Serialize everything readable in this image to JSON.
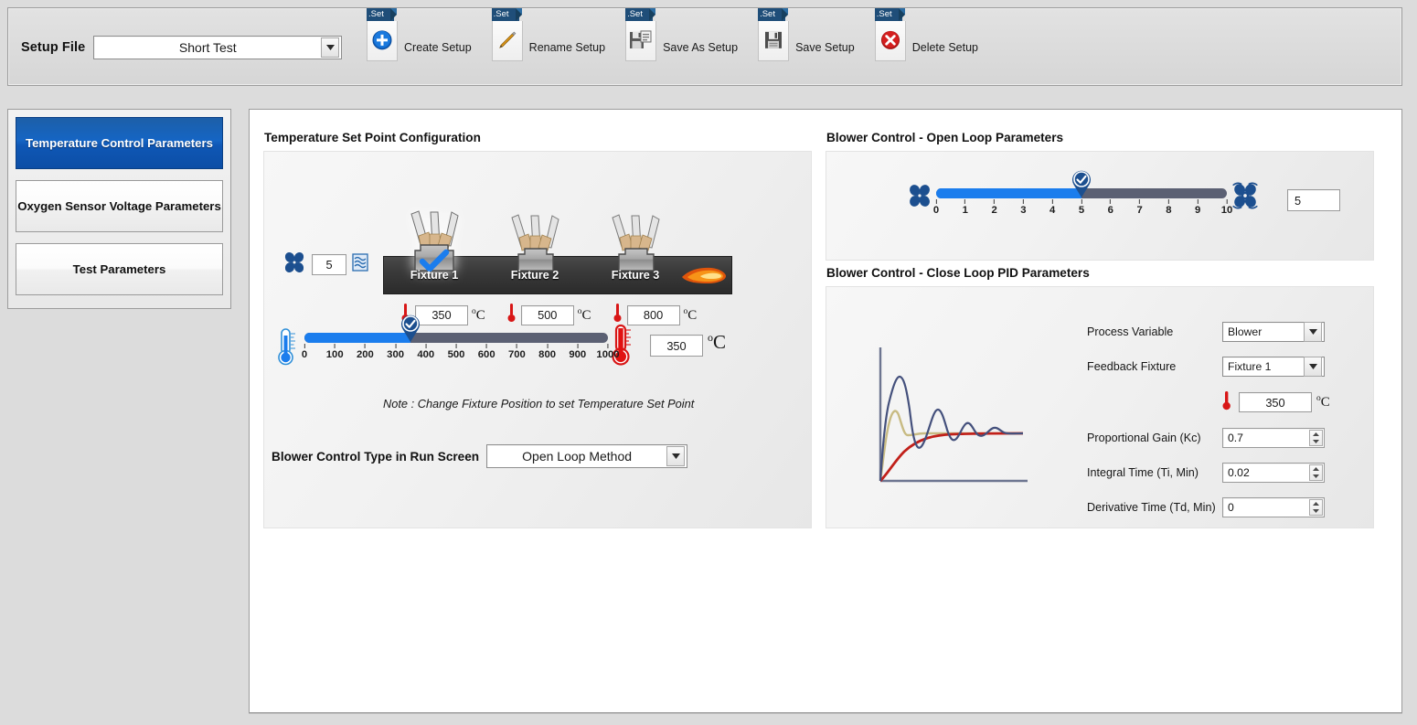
{
  "toolbar": {
    "setup_file_label": "Setup File",
    "setup_file_value": "Short Test",
    "buttons": [
      {
        "label": "Create Setup",
        "badge": ".Set",
        "icon": "plus-circle-icon"
      },
      {
        "label": "Rename Setup",
        "badge": ".Set",
        "icon": "pencil-icon"
      },
      {
        "label": "Save As Setup",
        "badge": ".Set",
        "icon": "save-as-floppy-icon"
      },
      {
        "label": "Save Setup",
        "badge": ".Set",
        "icon": "save-floppy-icon"
      },
      {
        "label": "Delete Setup",
        "badge": ".Set",
        "icon": "delete-circle-icon"
      }
    ]
  },
  "sidebar": {
    "items": [
      {
        "label": "Temperature Control Parameters",
        "active": true
      },
      {
        "label": "Oxygen Sensor Voltage Parameters",
        "active": false
      },
      {
        "label": "Test Parameters",
        "active": false
      }
    ]
  },
  "temperature_setpoint": {
    "title": "Temperature Set Point Configuration",
    "fan_count": "5",
    "fixtures": [
      {
        "name": "Fixture 1",
        "selected": true,
        "temperature": "350",
        "unit": "C"
      },
      {
        "name": "Fixture 2",
        "selected": false,
        "temperature": "500",
        "unit": "C"
      },
      {
        "name": "Fixture 3",
        "selected": false,
        "temperature": "800",
        "unit": "C"
      }
    ],
    "slider": {
      "min": 0,
      "max": 1000,
      "value": 350,
      "ticks": [
        "0",
        "100",
        "200",
        "300",
        "400",
        "500",
        "600",
        "700",
        "800",
        "900",
        "1000"
      ]
    },
    "value_box": "350",
    "value_unit": "C",
    "note": "Note : Change Fixture Position to set Temperature Set Point",
    "blower_control_type_label": "Blower Control Type in Run Screen",
    "blower_control_type_value": "Open Loop Method"
  },
  "open_loop": {
    "title": "Blower Control - Open Loop Parameters",
    "slider": {
      "min": 0,
      "max": 10,
      "value": 5,
      "ticks": [
        "0",
        "1",
        "2",
        "3",
        "4",
        "5",
        "6",
        "7",
        "8",
        "9",
        "10"
      ]
    },
    "value_box": "5"
  },
  "pid": {
    "title": "Blower Control - Close Loop PID Parameters",
    "process_variable_label": "Process Variable",
    "process_variable_value": "Blower",
    "feedback_fixture_label": "Feedback Fixture",
    "feedback_fixture_value": "Fixture 1",
    "feedback_temperature": "350",
    "feedback_temperature_unit": "C",
    "proportional_label": "Proportional Gain (Kc)",
    "proportional_value": "0.7",
    "integral_label": "Integral Time (Ti, Min)",
    "integral_value": "0.02",
    "derivative_label": "Derivative Time (Td, Min)",
    "derivative_value": "0"
  },
  "colors": {
    "accent_blue": "#1b7ded",
    "sidebar_active": "#0f57b5",
    "track_gray": "#5b6073",
    "badge_navy": "#1f4e79",
    "flame_orange": "#f07818",
    "thermo_red": "#d81616",
    "chart_navy": "#44507c",
    "chart_khaki": "#c8bb83",
    "chart_red": "#c1201a"
  }
}
